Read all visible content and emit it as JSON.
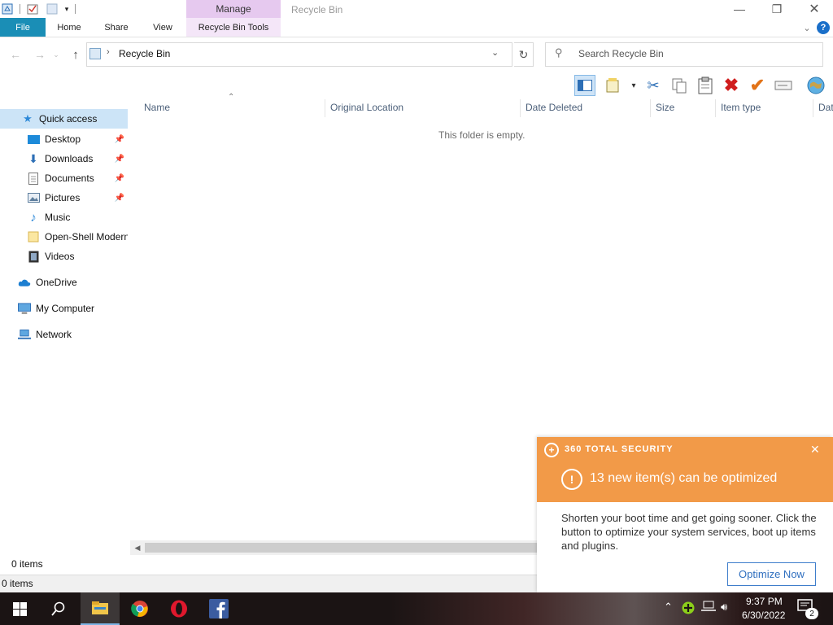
{
  "window": {
    "title": "Recycle Bin",
    "context_group": "Manage"
  },
  "ribbon": {
    "tabs": [
      {
        "label": "File"
      },
      {
        "label": "Home"
      },
      {
        "label": "Share"
      },
      {
        "label": "View"
      },
      {
        "label": "Recycle Bin Tools"
      }
    ]
  },
  "address": {
    "path": "Recycle Bin",
    "search_placeholder": "Search Recycle Bin"
  },
  "nav": {
    "items": [
      {
        "label": "Quick access",
        "icon": "star-icon",
        "pinned": false,
        "selected": true
      },
      {
        "label": "Desktop",
        "icon": "desktop-icon",
        "pinned": true
      },
      {
        "label": "Downloads",
        "icon": "download-icon",
        "pinned": true
      },
      {
        "label": "Documents",
        "icon": "document-icon",
        "pinned": true
      },
      {
        "label": "Pictures",
        "icon": "pictures-icon",
        "pinned": true
      },
      {
        "label": "Music",
        "icon": "music-icon",
        "pinned": false
      },
      {
        "label": "Open-Shell Modern",
        "icon": "folder-icon",
        "pinned": false
      },
      {
        "label": "Videos",
        "icon": "video-icon",
        "pinned": false
      },
      {
        "label": "OneDrive",
        "icon": "cloud-icon",
        "pinned": false
      },
      {
        "label": "My Computer",
        "icon": "computer-icon",
        "pinned": false
      },
      {
        "label": "Network",
        "icon": "network-icon",
        "pinned": false
      }
    ]
  },
  "columns": [
    "Name",
    "Original Location",
    "Date Deleted",
    "Size",
    "Item type",
    "Dat"
  ],
  "content": {
    "empty_message": "This folder is empty."
  },
  "status": {
    "items_count": "0 items",
    "items_count_bottom": "0 items"
  },
  "notification": {
    "brand": "360 TOTAL SECURITY",
    "title": "13 new item(s) can be optimized",
    "body": "Shorten your boot time and get going sooner. Click the button to optimize your system services, boot up items and plugins.",
    "button": "Optimize Now",
    "accent": "#f29a48"
  },
  "taskbar": {
    "time": "9:37 PM",
    "date": "6/30/2022",
    "notification_count": "2"
  }
}
